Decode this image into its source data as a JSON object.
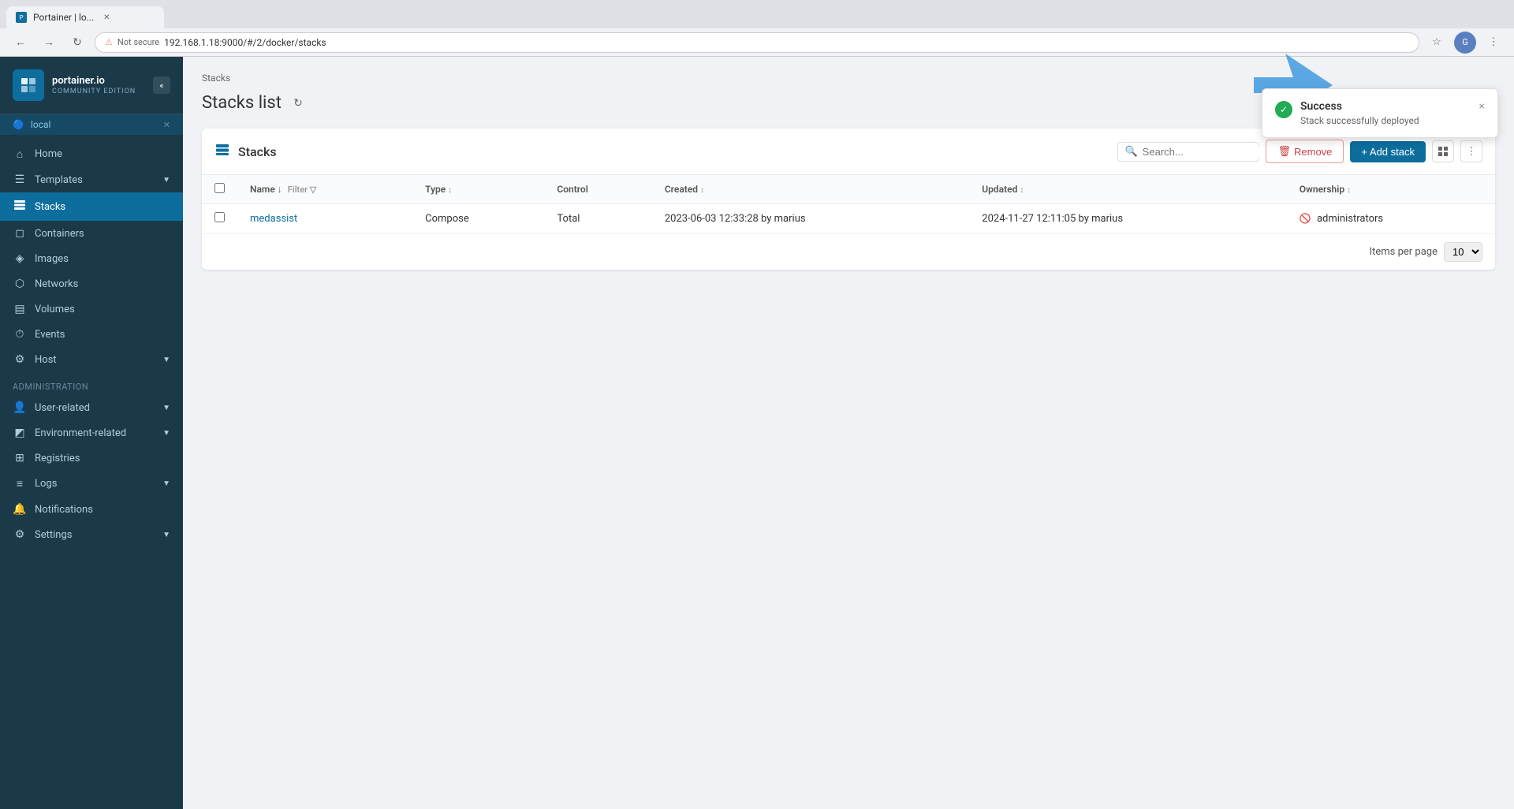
{
  "browser": {
    "tab_title": "Portainer | lo...",
    "address": "192.168.1.18:9000/#/2/docker/stacks",
    "warning_text": "Not secure"
  },
  "sidebar": {
    "logo_name": "portainer.io",
    "logo_sub": "COMMUNITY EDITION",
    "local_label": "local",
    "nav_items": [
      {
        "id": "home",
        "label": "Home",
        "icon": "⌂"
      },
      {
        "id": "templates",
        "label": "Templates",
        "icon": "☰",
        "hasChevron": true
      },
      {
        "id": "stacks",
        "label": "Stacks",
        "icon": "≡",
        "active": true
      },
      {
        "id": "containers",
        "label": "Containers",
        "icon": "◻"
      },
      {
        "id": "images",
        "label": "Images",
        "icon": "◈"
      },
      {
        "id": "networks",
        "label": "Networks",
        "icon": "⬡"
      },
      {
        "id": "volumes",
        "label": "Volumes",
        "icon": "▤"
      },
      {
        "id": "events",
        "label": "Events",
        "icon": "⏱"
      },
      {
        "id": "host",
        "label": "Host",
        "icon": "⚙",
        "hasChevron": true
      }
    ],
    "admin_section": "Administration",
    "admin_items": [
      {
        "id": "user-related",
        "label": "User-related",
        "icon": "👤",
        "hasChevron": true
      },
      {
        "id": "env-related",
        "label": "Environment-related",
        "icon": "◩",
        "hasChevron": true
      },
      {
        "id": "registries",
        "label": "Registries",
        "icon": "⊞"
      },
      {
        "id": "logs",
        "label": "Logs",
        "icon": "≡",
        "hasChevron": true
      },
      {
        "id": "notifications",
        "label": "Notifications",
        "icon": "🔔"
      },
      {
        "id": "settings",
        "label": "Settings",
        "icon": "⚙",
        "hasChevron": true
      }
    ]
  },
  "page": {
    "breadcrumb": "Stacks",
    "title": "Stacks list",
    "card_title": "Stacks",
    "search_placeholder": "Search...",
    "remove_label": "Remove",
    "add_stack_label": "+ Add stack",
    "items_per_page_label": "Items per page",
    "per_page_value": "10"
  },
  "table": {
    "columns": [
      {
        "id": "name",
        "label": "Name ↓",
        "filterable": true
      },
      {
        "id": "type",
        "label": "Type ↕"
      },
      {
        "id": "control",
        "label": "Control"
      },
      {
        "id": "created",
        "label": "Created ↕"
      },
      {
        "id": "updated",
        "label": "Updated ↕"
      },
      {
        "id": "ownership",
        "label": "Ownership ↕"
      }
    ],
    "rows": [
      {
        "name": "medassist",
        "type": "Compose",
        "control": "Total",
        "created": "2023-06-03 12:33:28 by marius",
        "updated": "2024-11-27 12:11:05 by marius",
        "ownership": "administrators"
      }
    ]
  },
  "toast": {
    "title": "Success",
    "message": "Stack successfully deployed",
    "close_label": "×"
  }
}
